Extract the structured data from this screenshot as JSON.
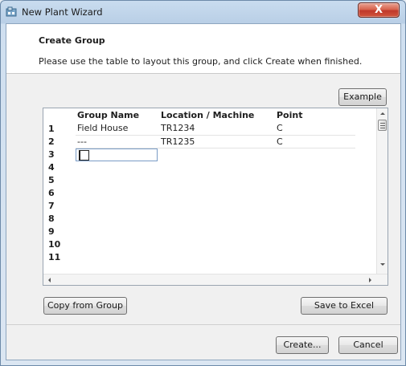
{
  "window": {
    "title": "New Plant Wizard",
    "close_glyph": "X"
  },
  "header": {
    "title": "Create Group",
    "description": "Please use the table to layout this group, and click Create when finished."
  },
  "buttons": {
    "example": "Example",
    "copy_from_group": "Copy from Group",
    "save_to_excel": "Save to Excel",
    "create": "Create...",
    "cancel": "Cancel"
  },
  "table": {
    "columns": [
      "",
      "Group Name",
      "Location / Machine",
      "Point"
    ],
    "rows": [
      {
        "num": "1",
        "group": "Field House",
        "location": "TR1234",
        "point": "C"
      },
      {
        "num": "2",
        "group": "---",
        "location": "TR1235",
        "point": "C"
      },
      {
        "num": "3",
        "group": "",
        "location": "",
        "point": ""
      },
      {
        "num": "4",
        "group": "",
        "location": "",
        "point": ""
      },
      {
        "num": "5",
        "group": "",
        "location": "",
        "point": ""
      },
      {
        "num": "6",
        "group": "",
        "location": "",
        "point": ""
      },
      {
        "num": "7",
        "group": "",
        "location": "",
        "point": ""
      },
      {
        "num": "8",
        "group": "",
        "location": "",
        "point": ""
      },
      {
        "num": "9",
        "group": "",
        "location": "",
        "point": ""
      },
      {
        "num": "10",
        "group": "",
        "location": "",
        "point": ""
      },
      {
        "num": "11",
        "group": "",
        "location": "",
        "point": ""
      }
    ]
  },
  "icons": {
    "app": "plant-wizard-icon",
    "scroll_up": "scroll-up-arrow-icon",
    "scroll_down": "scroll-down-arrow-icon",
    "scroll_left": "scroll-left-arrow-icon",
    "scroll_right": "scroll-right-arrow-icon"
  }
}
